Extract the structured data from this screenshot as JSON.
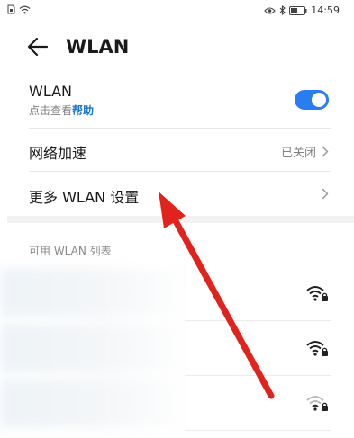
{
  "status_bar": {
    "time": "14:59"
  },
  "header": {
    "title": "WLAN"
  },
  "wlan_row": {
    "title": "WLAN",
    "subtitle": "点击查看",
    "help_link": "帮助",
    "enabled": true
  },
  "network_accel_row": {
    "title": "网络加速",
    "value": "已关闭"
  },
  "more_settings_row": {
    "title": "更多 WLAN 设置"
  },
  "available_list": {
    "label": "可用 WLAN 列表"
  },
  "colors": {
    "accent": "#2a7df0",
    "link": "#1976d2",
    "annotation_arrow": "#e0231c"
  },
  "icons": [
    "back-arrow-icon",
    "chevron-right-icon",
    "wifi-locked-icon",
    "eye-icon",
    "bluetooth-icon",
    "battery-icon",
    "wifi-status-icon",
    "sim-icon"
  ]
}
